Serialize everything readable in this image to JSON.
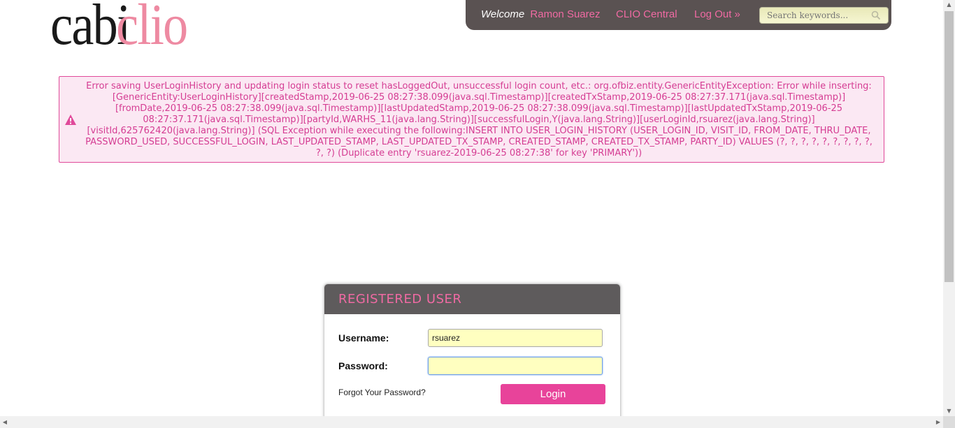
{
  "logo": {
    "part1": "cabi",
    "part2": "clio"
  },
  "header": {
    "welcome_label": "Welcome",
    "user_name": "Ramon Suarez",
    "clio_central": "CLIO Central",
    "logout": "Log Out »",
    "search_placeholder": "Search keywords..."
  },
  "error": {
    "message": "Error saving UserLoginHistory and updating login status to reset hasLoggedOut, unsuccessful login count, etc.: org.ofbiz.entity.GenericEntityException: Error while inserting: [GenericEntity:UserLoginHistory][createdStamp,2019-06-25 08:27:38.099(java.sql.Timestamp)][createdTxStamp,2019-06-25 08:27:37.171(java.sql.Timestamp)][fromDate,2019-06-25 08:27:38.099(java.sql.Timestamp)][lastUpdatedStamp,2019-06-25 08:27:38.099(java.sql.Timestamp)][lastUpdatedTxStamp,2019-06-25 08:27:37.171(java.sql.Timestamp)][partyId,WARHS_11(java.lang.String)][successfulLogin,Y(java.lang.String)][userLoginId,rsuarez(java.lang.String)][visitId,625762420(java.lang.String)] (SQL Exception while executing the following:INSERT INTO USER_LOGIN_HISTORY (USER_LOGIN_ID, VISIT_ID, FROM_DATE, THRU_DATE, PASSWORD_USED, SUCCESSFUL_LOGIN, LAST_UPDATED_STAMP, LAST_UPDATED_TX_STAMP, CREATED_STAMP, CREATED_TX_STAMP, PARTY_ID) VALUES (?, ?, ?, ?, ?, ?, ?, ?, ?, ?, ?) (Duplicate entry 'rsuarez-2019-06-25 08:27:38' for key 'PRIMARY'))"
  },
  "login": {
    "title": "REGISTERED USER",
    "username_label": "Username:",
    "username_value": "rsuarez",
    "password_label": "Password:",
    "password_value": "",
    "forgot_link": "Forgot Your Password?",
    "login_button": "Login"
  },
  "colors": {
    "accent": "#f06aa3",
    "button": "#e8439a",
    "header_bg": "#5a5252",
    "error_text": "#d53d93"
  }
}
